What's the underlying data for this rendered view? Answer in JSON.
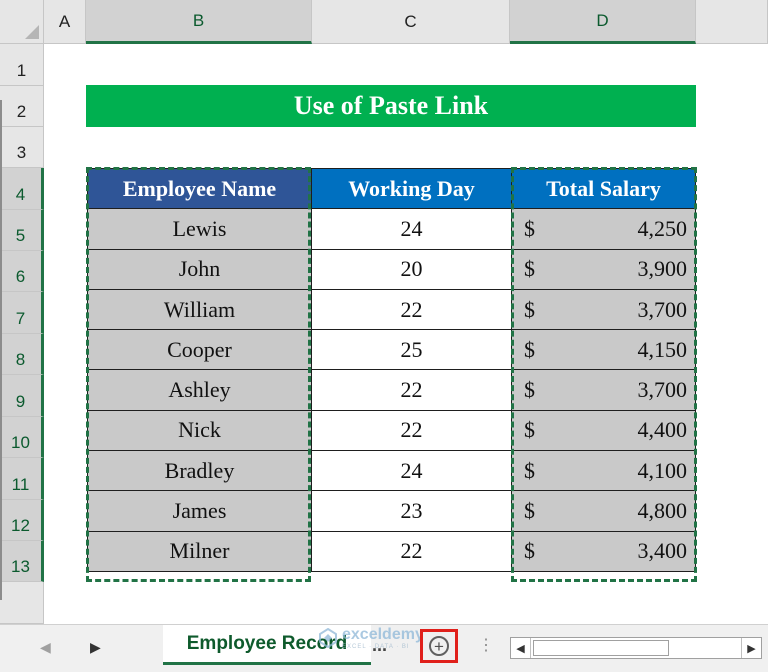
{
  "columns": [
    "A",
    "B",
    "C",
    "D"
  ],
  "rows": [
    "1",
    "2",
    "3",
    "4",
    "5",
    "6",
    "7",
    "8",
    "9",
    "10",
    "11",
    "12",
    "13"
  ],
  "title": "Use of Paste Link",
  "table": {
    "headers": [
      "Employee Name",
      "Working Day",
      "Total Salary"
    ],
    "currency_symbol": "$",
    "rows": [
      {
        "name": "Lewis",
        "days": "24",
        "salary": "4,250"
      },
      {
        "name": "John",
        "days": "20",
        "salary": "3,900"
      },
      {
        "name": "William",
        "days": "22",
        "salary": "3,700"
      },
      {
        "name": "Cooper",
        "days": "25",
        "salary": "4,150"
      },
      {
        "name": "Ashley",
        "days": "22",
        "salary": "3,700"
      },
      {
        "name": "Nick",
        "days": "22",
        "salary": "4,400"
      },
      {
        "name": "Bradley",
        "days": "24",
        "salary": "4,100"
      },
      {
        "name": "James",
        "days": "23",
        "salary": "4,800"
      },
      {
        "name": "Milner",
        "days": "22",
        "salary": "3,400"
      }
    ]
  },
  "sheet_tab": {
    "label": "Employee Record",
    "more": "..."
  },
  "nav": {
    "prev_icon": "chevron-left-icon",
    "next_icon": "chevron-right-icon"
  },
  "add_sheet_icon": "plus-circle-icon",
  "watermark": {
    "brand": "exceldemy",
    "sub": "EXCEL · DATA · BI"
  },
  "colors": {
    "title_bg": "#00b050",
    "header_b": "#2f5597",
    "header_cd": "#0070c0",
    "cell_gray": "#c9c9c9",
    "selection": "#217346",
    "highlight_box": "#e0201b"
  }
}
